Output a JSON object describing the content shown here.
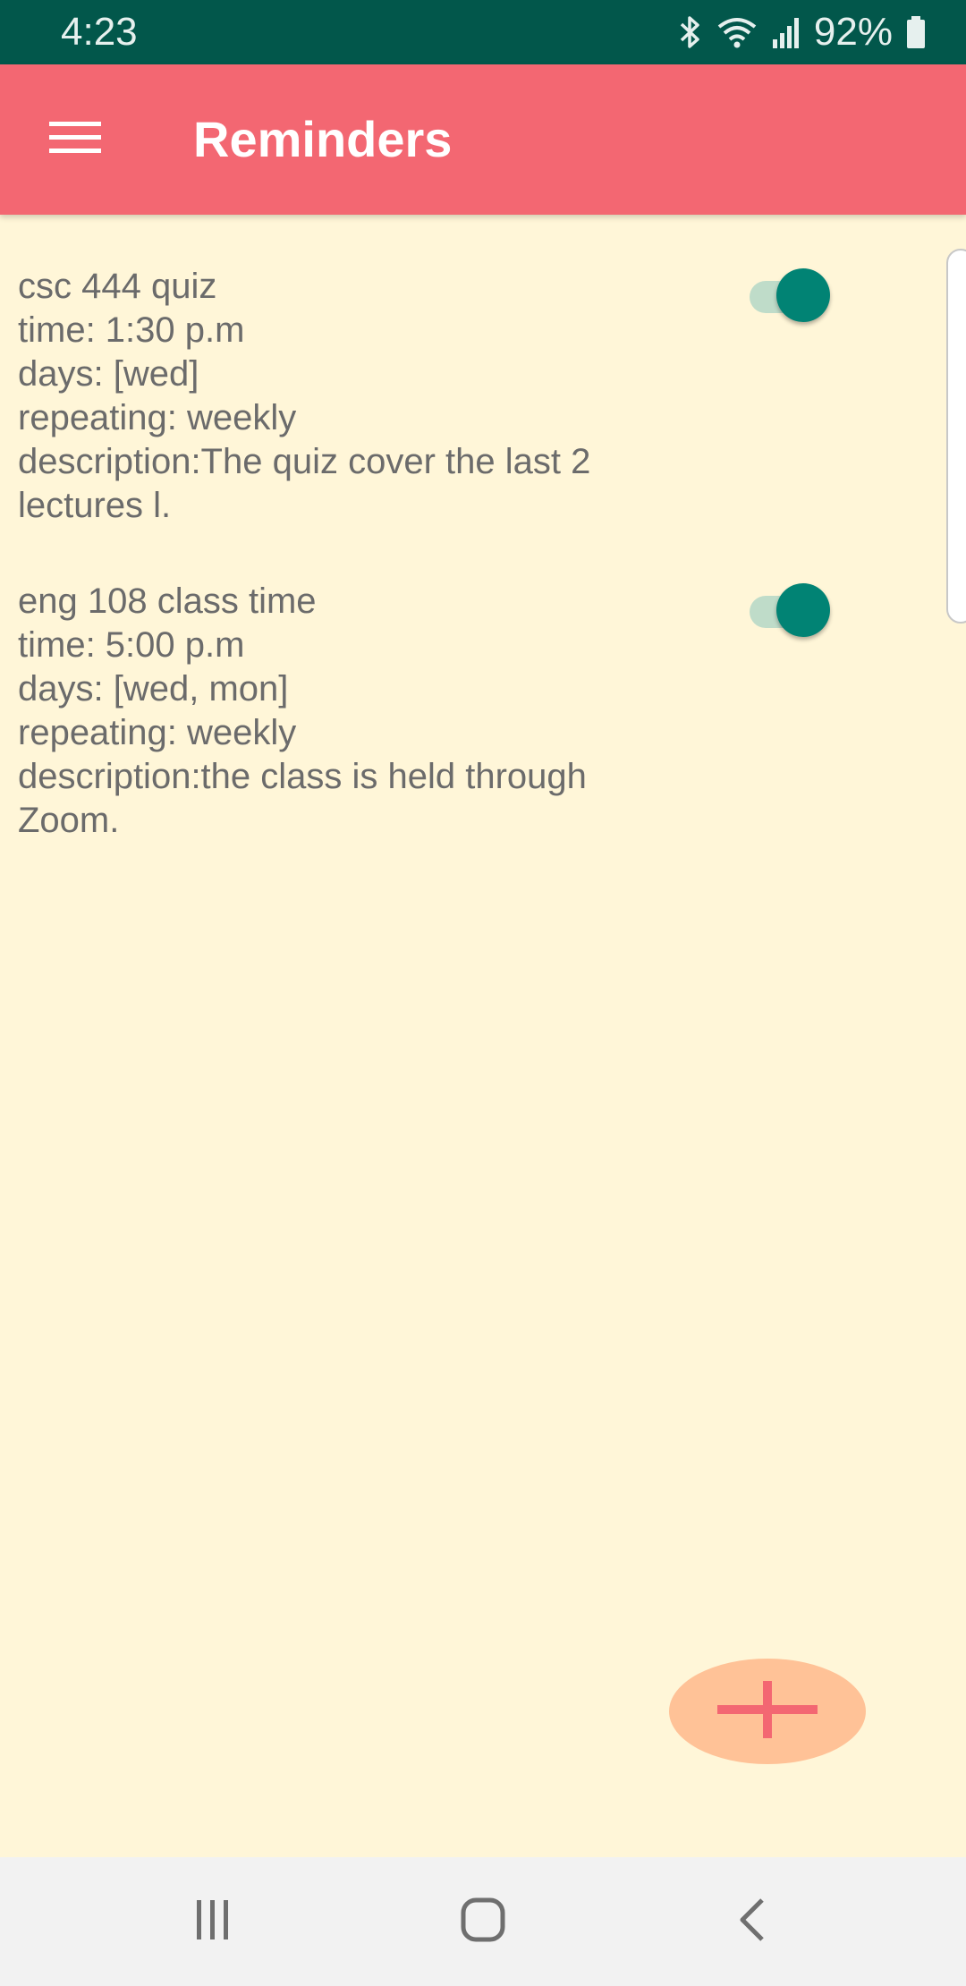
{
  "status_bar": {
    "time": "4:23",
    "battery": "92%",
    "icons": [
      "bluetooth-icon",
      "wifi-icon",
      "signal-icon",
      "battery-icon"
    ]
  },
  "app_bar": {
    "title": "Reminders",
    "menu_icon": "hamburger-menu-icon",
    "color": "#F36772"
  },
  "reminders": [
    {
      "title": "csc 444 quiz",
      "time": "time: 1:30 p.m",
      "days": "days: [wed]",
      "repeating": "repeating: weekly",
      "description_line1": "description:The quiz cover the last 2",
      "description_line2": "lectures l.",
      "enabled": true
    },
    {
      "title": "eng 108 class time",
      "time": "time: 5:00 p.m",
      "days": "days: [wed, mon]",
      "repeating": "repeating: weekly",
      "description_line1": "description:the class is held through",
      "description_line2": "Zoom.",
      "enabled": true
    }
  ],
  "fab": {
    "icon": "plus-icon",
    "color": "#FFC297",
    "icon_color": "#F36772"
  },
  "nav_bar": {
    "buttons": [
      "recent-apps-icon",
      "home-icon",
      "back-icon"
    ]
  },
  "colors": {
    "background": "#FFF6D8",
    "status_bar": "#02574B",
    "toggle_on": "#018374"
  }
}
